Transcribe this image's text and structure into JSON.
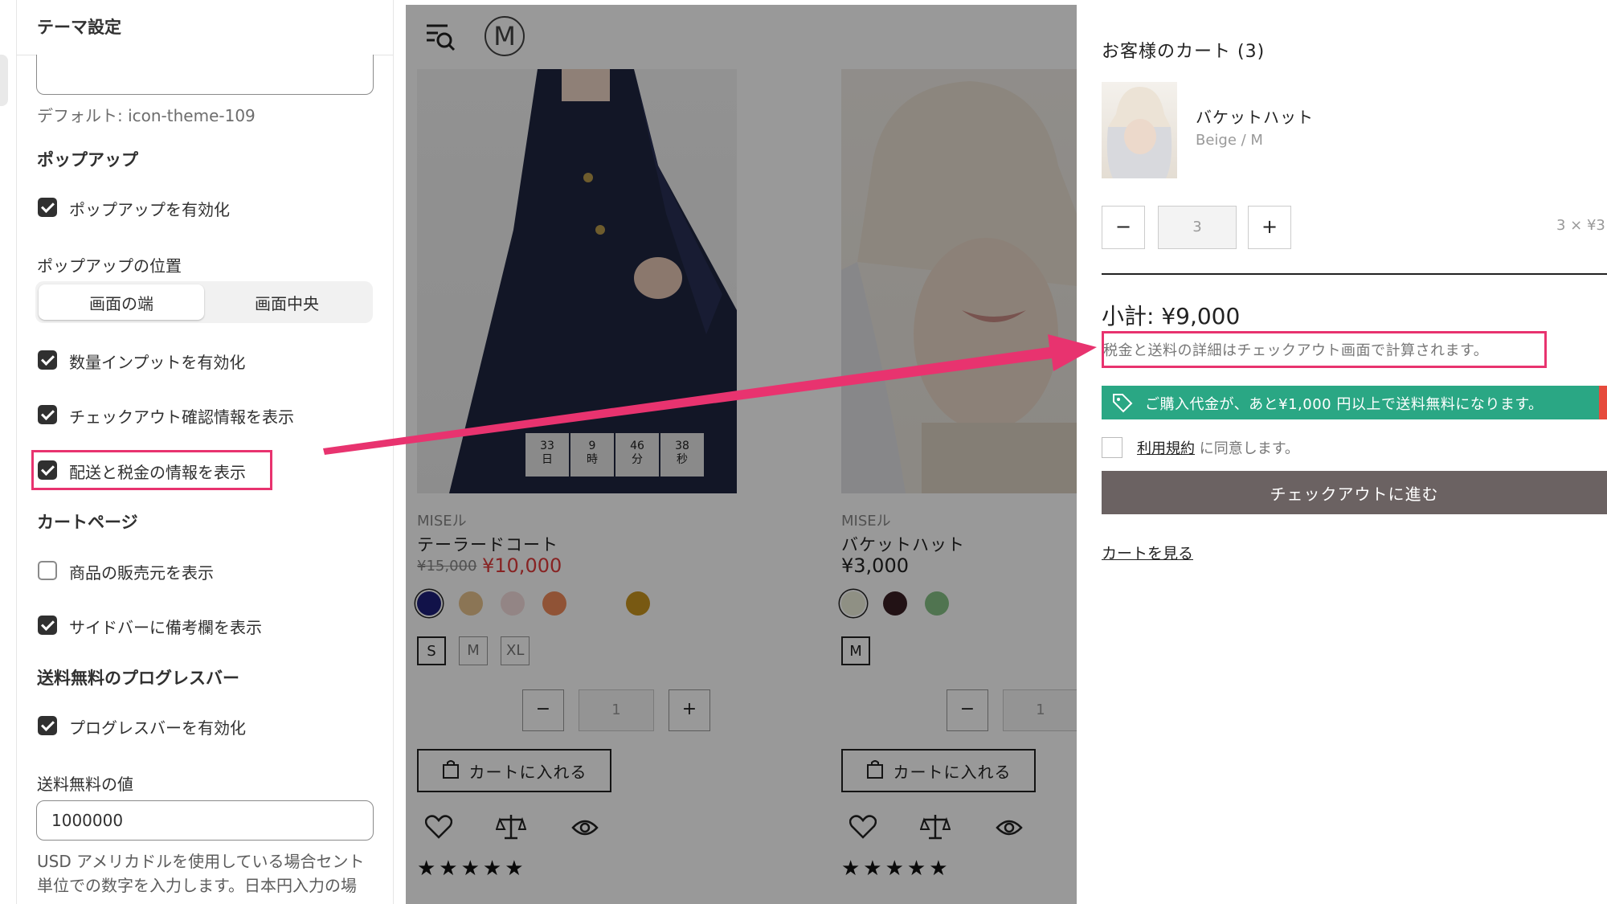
{
  "settings": {
    "title": "テーマ設定",
    "icon_default_hint": "デフォルト: icon-theme-109",
    "popup_heading": "ポップアップ",
    "enable_popup": "ポップアップを有効化",
    "popup_position_label": "ポップアップの位置",
    "position_options": [
      "画面の端",
      "画面中央"
    ],
    "enable_quantity_input": "数量インプットを有効化",
    "show_checkout_confirm": "チェックアウト確認情報を表示",
    "show_shipping_tax": "配送と税金の情報を表示",
    "cart_page_heading": "カートページ",
    "show_vendor": "商品の販売元を表示",
    "show_sidebar_notes": "サイドバーに備考欄を表示",
    "progress_heading": "送料無料のプログレスバー",
    "enable_progress": "プログレスバーを有効化",
    "free_shipping_label": "送料無料の値",
    "free_shipping_value": "1000000",
    "help_line1": "USD アメリカドルを使用している場合セント",
    "help_line2": "単位での数字を入力します。日本円入力の場"
  },
  "store": {
    "logo_letter": "M",
    "product1": {
      "vendor": "MISEル",
      "name": "テーラードコート",
      "compare_price": "¥15,000",
      "price": "¥10,000",
      "countdown": [
        {
          "num": "33",
          "unit": "日"
        },
        {
          "num": "9",
          "unit": "時"
        },
        {
          "num": "46",
          "unit": "分"
        },
        {
          "num": "38",
          "unit": "秒"
        }
      ],
      "sizes": [
        "S",
        "M",
        "XL"
      ],
      "qty": "1",
      "add_to_cart": "カートに入れる",
      "stars": "★★★★★"
    },
    "product2": {
      "vendor": "MISEル",
      "name": "バケットハット",
      "price": "¥3,000",
      "sizes": [
        "M"
      ],
      "qty": "1",
      "add_to_cart": "カートに入れる",
      "stars": "★★★★★"
    },
    "qty_minus": "−",
    "qty_plus": "+"
  },
  "cart": {
    "title": "お客様のカート (3)",
    "item_name": "バケットハット",
    "item_variant": "Beige / M",
    "qty": "3",
    "line_price": "3 × ¥3",
    "minus": "−",
    "plus": "+",
    "subtotal": "小計: ¥9,000",
    "tax_note": "税金と送料の詳細はチェックアウト画面で計算されます。",
    "shipping_message": "ご購入代金が、あと¥1,000 円以上で送料無料になります。",
    "terms_link": "利用規約",
    "terms_suffix": " に同意します。",
    "checkout_button": "チェックアウトに進む",
    "view_cart": "カートを見る"
  },
  "colors": {
    "highlight": "#e8336f",
    "shipping_bar": "#2aa784",
    "sale_price": "#e23b3b",
    "checkout_button": "#6b6262"
  }
}
